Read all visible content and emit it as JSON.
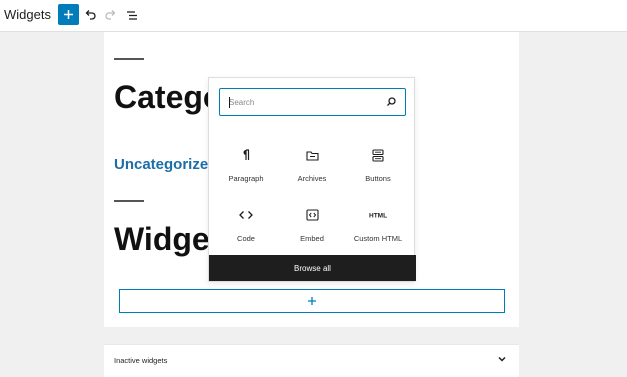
{
  "header": {
    "title": "Widgets",
    "add_icon": "plus-icon",
    "undo_icon": "undo-icon",
    "redo_icon": "redo-icon",
    "list_view_icon": "list-view-icon"
  },
  "canvas": {
    "heading_1": "Categories",
    "link_text": "Uncategorized",
    "heading_2": "Widgets",
    "appender_icon": "plus-icon"
  },
  "inserter": {
    "search_placeholder": "Search",
    "blocks": [
      {
        "label": "Paragraph",
        "icon": "paragraph-icon"
      },
      {
        "label": "Archives",
        "icon": "archives-icon"
      },
      {
        "label": "Buttons",
        "icon": "buttons-icon"
      },
      {
        "label": "Code",
        "icon": "code-icon"
      },
      {
        "label": "Embed",
        "icon": "embed-icon"
      },
      {
        "label": "Custom HTML",
        "icon": "html-icon"
      }
    ],
    "browse_all": "Browse all"
  },
  "inactive": {
    "label": "Inactive widgets"
  },
  "colors": {
    "accent": "#007cba",
    "link": "#1b6fa8",
    "dark": "#1e1e1e"
  }
}
